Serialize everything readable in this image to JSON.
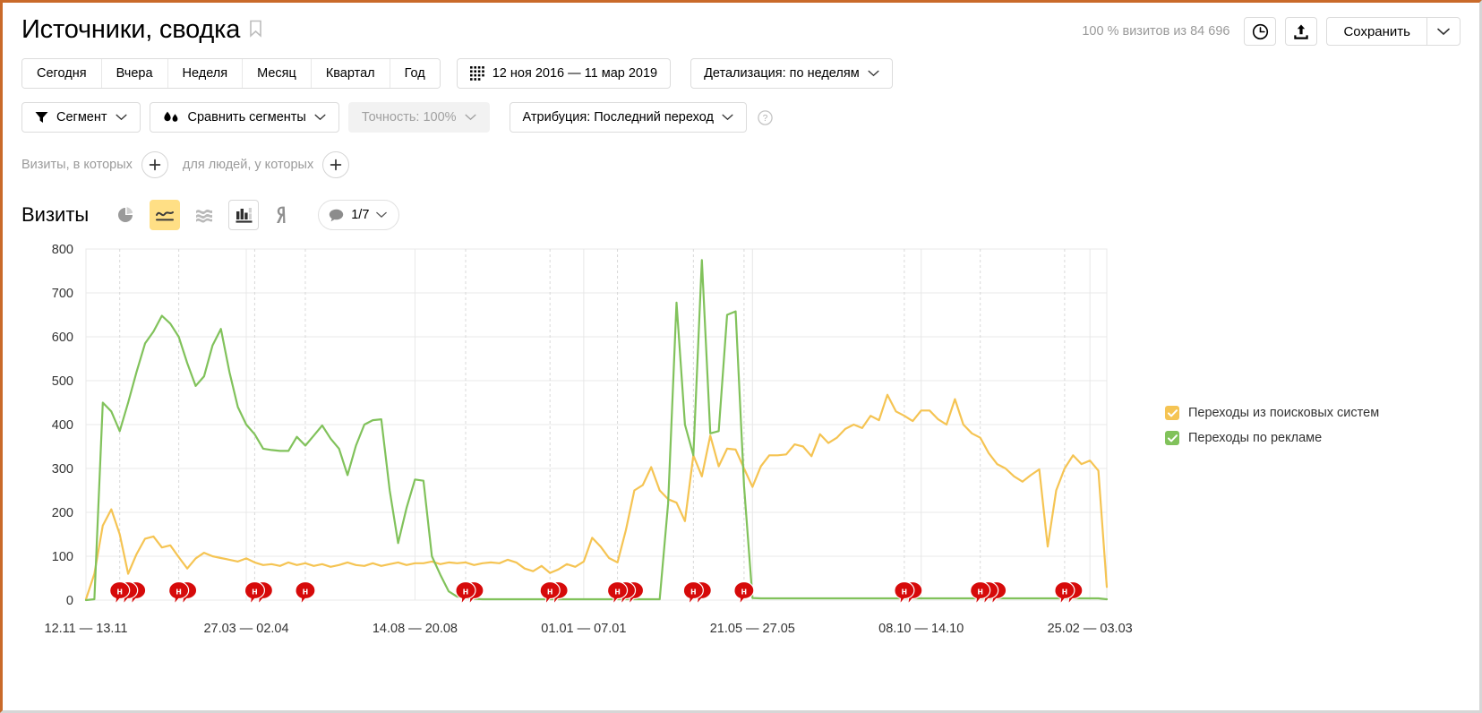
{
  "header": {
    "title": "Источники, сводка",
    "bookmark_icon": "bookmark-icon",
    "visits_note": "100 % визитов из 84 696",
    "history_icon": "clock-icon",
    "export_icon": "export-icon",
    "save_label": "Сохранить",
    "save_caret_icon": "chevron-down-icon"
  },
  "period_buttons": [
    {
      "label": "Сегодня"
    },
    {
      "label": "Вчера"
    },
    {
      "label": "Неделя"
    },
    {
      "label": "Месяц"
    },
    {
      "label": "Квартал"
    },
    {
      "label": "Год"
    }
  ],
  "date_range": {
    "icon": "calendar-icon",
    "label": "12 ноя 2016 — 11 мар 2019"
  },
  "detail_level": {
    "label": "Детализация: по неделям",
    "caret_icon": "chevron-down-icon"
  },
  "controls": {
    "segment": {
      "icon": "funnel-icon",
      "label": "Сегмент",
      "caret_icon": "chevron-down-icon"
    },
    "compare_segments": {
      "icon": "drops-icon",
      "label": "Сравнить сегменты",
      "caret_icon": "chevron-down-icon"
    },
    "accuracy": {
      "label": "Точность: 100%",
      "caret_icon": "chevron-down-icon",
      "disabled": true
    },
    "attribution": {
      "label": "Атрибуция: Последний переход",
      "caret_icon": "chevron-down-icon"
    },
    "help_icon": "question-icon"
  },
  "filters": {
    "visits_label": "Визиты, в которых",
    "visits_add_icon": "plus-icon",
    "people_label": "для людей, у которых",
    "people_add_icon": "plus-icon"
  },
  "metric_bar": {
    "title": "Визиты",
    "view_buttons": [
      {
        "name": "pie-chart-icon",
        "active": false,
        "outlined": false
      },
      {
        "name": "line-chart-icon",
        "active": true,
        "outlined": false
      },
      {
        "name": "area-chart-icon",
        "active": false,
        "outlined": false
      },
      {
        "name": "bar-chart-icon",
        "active": false,
        "outlined": true
      },
      {
        "name": "map-pin-icon",
        "active": false,
        "outlined": false
      }
    ],
    "comments": {
      "icon": "comment-icon",
      "label": "1/7",
      "caret_icon": "chevron-down-icon"
    }
  },
  "colors": {
    "search": "#f5c453",
    "ads": "#81c25b",
    "grid": "#e8e8e8",
    "axis_text": "#333333",
    "annotation": "#d60a0a",
    "accent": "#ffdf85"
  },
  "chart_data": {
    "type": "line",
    "title": "Визиты",
    "xlabel": "",
    "ylabel": "",
    "ylim": [
      0,
      800
    ],
    "yticks": [
      0,
      100,
      200,
      300,
      400,
      500,
      600,
      700,
      800
    ],
    "grid": true,
    "legend_position": "right",
    "xtick_labels": [
      "12.11 — 13.11",
      "27.03 — 02.04",
      "14.08 — 20.08",
      "01.01 — 07.01",
      "21.05 — 27.05",
      "08.10 — 14.10",
      "25.02 — 03.03"
    ],
    "xtick_indices": [
      0,
      19,
      39,
      59,
      79,
      99,
      119
    ],
    "n_points": 122,
    "series": [
      {
        "name": "Переходы из поисковых систем",
        "color": "#f5c453",
        "values": [
          2,
          60,
          170,
          207,
          150,
          60,
          105,
          140,
          145,
          120,
          125,
          98,
          72,
          95,
          108,
          100,
          96,
          92,
          88,
          95,
          86,
          80,
          82,
          78,
          86,
          80,
          84,
          78,
          82,
          76,
          80,
          86,
          80,
          78,
          84,
          78,
          82,
          86,
          80,
          84,
          84,
          88,
          82,
          86,
          84,
          86,
          80,
          84,
          86,
          84,
          92,
          86,
          72,
          66,
          78,
          62,
          70,
          82,
          76,
          88,
          142,
          122,
          96,
          86,
          160,
          250,
          262,
          303,
          250,
          230,
          222,
          180,
          330,
          282,
          375,
          305,
          345,
          343,
          300,
          258,
          305,
          330,
          330,
          332,
          355,
          350,
          328,
          378,
          358,
          370,
          390,
          400,
          392,
          420,
          410,
          468,
          430,
          420,
          408,
          432,
          432,
          412,
          400,
          458,
          400,
          380,
          370,
          335,
          310,
          300,
          282,
          270,
          285,
          298,
          122,
          250,
          300,
          330,
          310,
          318,
          295,
          30
        ],
        "labels": []
      },
      {
        "name": "Переходы по рекламе",
        "color": "#81c25b",
        "values": [
          0,
          2,
          450,
          430,
          385,
          450,
          520,
          585,
          612,
          648,
          630,
          600,
          540,
          488,
          510,
          580,
          618,
          520,
          440,
          400,
          378,
          345,
          342,
          340,
          340,
          372,
          352,
          375,
          398,
          368,
          345,
          285,
          352,
          400,
          410,
          412,
          250,
          130,
          210,
          275,
          272,
          100,
          58,
          20,
          8,
          5,
          3,
          2,
          2,
          2,
          2,
          2,
          2,
          2,
          2,
          2,
          2,
          2,
          2,
          2,
          2,
          2,
          2,
          2,
          2,
          2,
          2,
          2,
          2,
          220,
          678,
          400,
          330,
          775,
          380,
          385,
          650,
          658,
          260,
          5,
          4,
          4,
          4,
          4,
          4,
          4,
          4,
          4,
          4,
          4,
          4,
          4,
          4,
          4,
          4,
          4,
          4,
          4,
          4,
          4,
          4,
          4,
          4,
          4,
          4,
          4,
          4,
          4,
          4,
          4,
          4,
          4,
          4,
          4,
          4,
          4,
          4,
          4,
          4,
          4,
          4,
          2
        ],
        "labels": []
      }
    ],
    "annotations": [
      {
        "index": 4,
        "count": 3
      },
      {
        "index": 11,
        "count": 2
      },
      {
        "index": 20,
        "count": 2
      },
      {
        "index": 26,
        "count": 1
      },
      {
        "index": 45,
        "count": 2
      },
      {
        "index": 55,
        "count": 2
      },
      {
        "index": 63,
        "count": 3
      },
      {
        "index": 72,
        "count": 2
      },
      {
        "index": 78,
        "count": 1
      },
      {
        "index": 97,
        "count": 2
      },
      {
        "index": 106,
        "count": 3
      },
      {
        "index": 116,
        "count": 2
      }
    ]
  }
}
